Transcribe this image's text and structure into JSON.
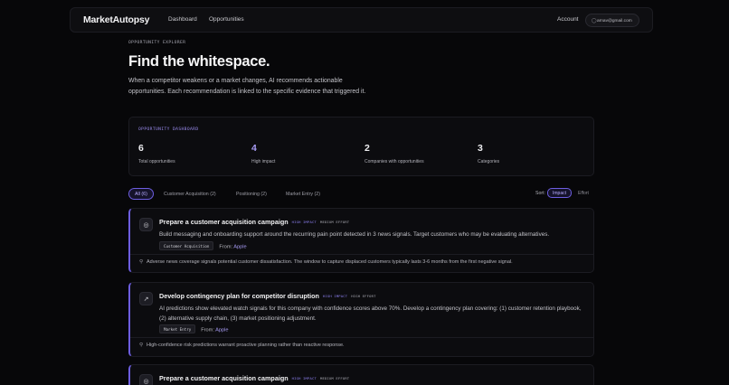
{
  "nav": {
    "brand": "MarketAutopsy",
    "links": [
      "Dashboard",
      "Opportunities"
    ],
    "account_label": "Account",
    "email": "arnav@gmail.com"
  },
  "hero": {
    "eyebrow": "OPPORTUNITY EXPLORER",
    "title": "Find the whitespace.",
    "description": "When a competitor weakens or a market changes, AI recommends actionable opportunities. Each recommendation is linked to the specific evidence that triggered it."
  },
  "dashboard": {
    "eyebrow": "OPPORTUNITY DASHBOARD",
    "stats": [
      {
        "value": "6",
        "label": "Total opportunities"
      },
      {
        "value": "4",
        "label": "High impact"
      },
      {
        "value": "2",
        "label": "Companies with opportunities"
      },
      {
        "value": "3",
        "label": "Categories"
      }
    ]
  },
  "filters": [
    "All (6)",
    "Customer Acquisition (2)",
    "Positioning (2)",
    "Market Entry (2)"
  ],
  "sort": {
    "label": "Sort:",
    "options": [
      "Impact",
      "Effort"
    ],
    "selected": "Impact"
  },
  "from_label": "From:",
  "cards": [
    {
      "icon": "target-icon",
      "title": "Prepare a customer acquisition campaign",
      "impact": "HIGH IMPACT",
      "effort": "MEDIUM EFFORT",
      "body": "Build messaging and onboarding support around the recurring pain point detected in 3 news signals. Target customers who may be evaluating alternatives.",
      "tag": "Customer Acquisition",
      "from": "Apple",
      "evidence": "Adverse news coverage signals potential customer dissatisfaction. The window to capture displaced customers typically lasts 3-6 months from the first negative signal."
    },
    {
      "icon": "trend-up-icon",
      "title": "Develop contingency plan for competitor disruption",
      "impact": "HIGH IMPACT",
      "effort": "HIGH EFFORT",
      "body": "AI predictions show elevated watch signals for this company with confidence scores above 70%. Develop a contingency plan covering: (1) customer retention playbook, (2) alternative supply chain, (3) market positioning adjustment.",
      "tag": "Market Entry",
      "from": "Apple",
      "evidence": "High-confidence risk predictions warrant proactive planning rather than reactive response."
    },
    {
      "icon": "target-icon",
      "title": "Prepare a customer acquisition campaign",
      "impact": "HIGH IMPACT",
      "effort": "MEDIUM EFFORT"
    }
  ]
}
